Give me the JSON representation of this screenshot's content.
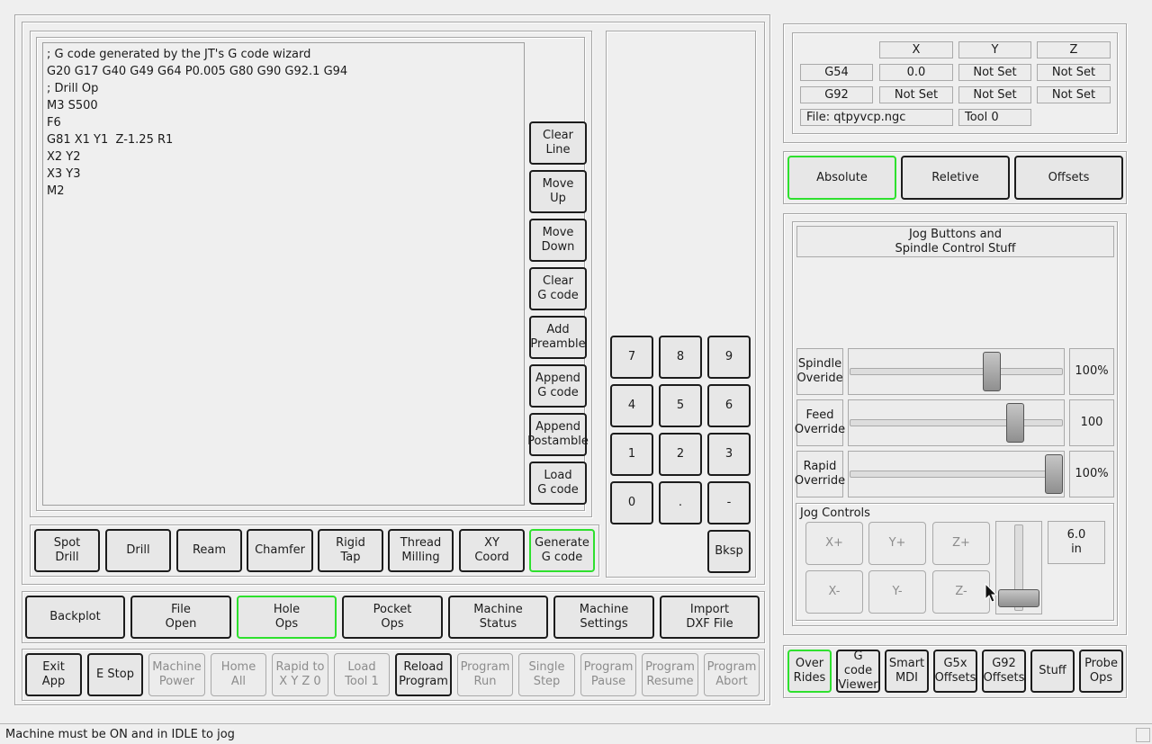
{
  "gcode": {
    "lines": [
      "; G code generated by the JT's G code wizard",
      "G20 G17 G40 G49 G64 P0.005 G80 G90 G92.1 G94",
      "; Drill Op",
      "M3 S500",
      "F6",
      "G81 X1 Y1  Z-1.25 R1",
      "X2 Y2",
      "X3 Y3",
      "M2"
    ]
  },
  "edit_buttons": [
    "Clear\nLine",
    "Move\nUp",
    "Move\nDown",
    "Clear\nG code",
    "Add\nPreamble",
    "Append\nG code",
    "Append\nPostamble",
    "Load\nG code"
  ],
  "keypad": [
    "7",
    "8",
    "9",
    "4",
    "5",
    "6",
    "1",
    "2",
    "3",
    "0",
    ".",
    "-"
  ],
  "keypad_backspace": "Bksp",
  "op_buttons": [
    "Spot\nDrill",
    "Drill",
    "Ream",
    "Chamfer",
    "Rigid\nTap",
    "Thread\nMilling",
    "XY\nCoord",
    "Generate\nG code"
  ],
  "nav_buttons": [
    "Backplot",
    "File\nOpen",
    "Hole\nOps",
    "Pocket\nOps",
    "Machine\nStatus",
    "Machine\nSettings",
    "Import\nDXF File"
  ],
  "machine_buttons": [
    "Exit\nApp",
    "E Stop",
    "Machine\nPower",
    "Home\nAll",
    "Rapid to\nX Y Z 0",
    "Load\nTool 1",
    "Reload\nProgram",
    "Program\nRun",
    "Single\nStep",
    "Program\nPause",
    "Program\nResume",
    "Program\nAbort"
  ],
  "dro": {
    "headers": [
      "X",
      "Y",
      "Z"
    ],
    "rows": [
      {
        "label": "G54",
        "values": [
          "0.0",
          "Not Set",
          "Not Set"
        ]
      },
      {
        "label": "G92",
        "values": [
          "Not Set",
          "Not Set",
          "Not Set"
        ]
      }
    ],
    "file": "File: qtpyvcp.ngc",
    "tool": "Tool 0"
  },
  "mode_buttons": [
    "Absolute",
    "Reletive",
    "Offsets"
  ],
  "jog_panel": {
    "title": "Jog Buttons and\nSpindle Control Stuff",
    "overrides": [
      {
        "label": "Spindle\nOveride",
        "value": "100%",
        "level": 0.68
      },
      {
        "label": "Feed\nOverride",
        "value": "100",
        "level": 0.8
      },
      {
        "label": "Rapid\nOverride",
        "value": "100%",
        "level": 1.0
      }
    ],
    "jog_controls_label": "Jog Controls",
    "jog_buttons": [
      "X+",
      "Y+",
      "Z+",
      "X-",
      "Y-",
      "Z-"
    ],
    "increment": "6.0\nin",
    "jog_slider_level": 0.05
  },
  "tab_buttons": [
    "Over\nRides",
    "G code\nViewer",
    "Smart\nMDI",
    "G5x\nOffsets",
    "G92\nOffsets",
    "Stuff",
    "Probe\nOps"
  ],
  "status_message": "Machine must be ON and in IDLE to jog",
  "colors": {
    "active_border": "#2ee02e",
    "button_border": "#1c1c1c",
    "disabled_text": "#8c8c8c"
  }
}
